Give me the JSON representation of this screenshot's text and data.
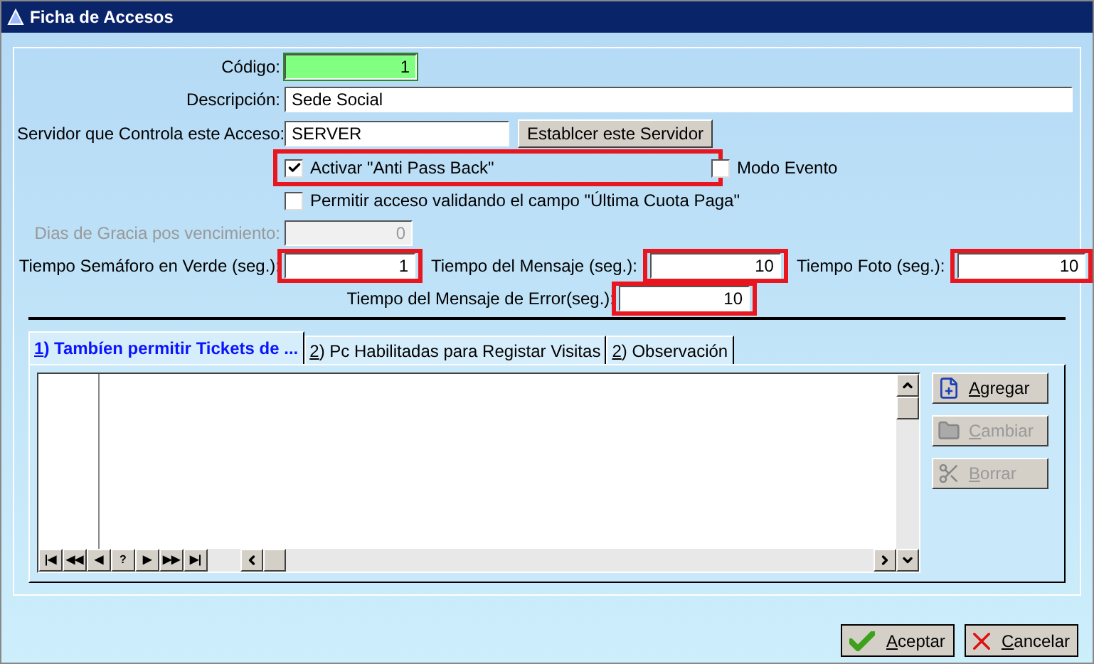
{
  "window": {
    "title": "Ficha de Accesos"
  },
  "form": {
    "codigo": {
      "label": "Código:",
      "value": "1"
    },
    "descripcion": {
      "label": "Descripción:",
      "value": "Sede Social"
    },
    "servidor": {
      "label": "Servidor que Controla este Acceso:",
      "value": "SERVER",
      "button": "Establcer este Servidor"
    },
    "anti_pass_back": {
      "label": "Activar \"Anti Pass Back\"",
      "checked": true,
      "highlighted": true
    },
    "modo_evento": {
      "label": "Modo Evento",
      "checked": false,
      "highlighted": false
    },
    "permitir": {
      "label": "Permitir acceso validando el campo \"Última Cuota Paga\"",
      "checked": false,
      "highlighted": false
    },
    "dias_gracia": {
      "label": "Dias de Gracia pos vencimiento:",
      "value": "0",
      "disabled": true,
      "highlighted": false
    },
    "tiempo_semaforo": {
      "label": "Tiempo Semáforo en Verde (seg.):",
      "value": "1",
      "disabled": false,
      "highlighted": true
    },
    "tiempo_mensaje": {
      "label": "Tiempo del Mensaje (seg.):",
      "value": "10",
      "disabled": false,
      "highlighted": true
    },
    "tiempo_foto": {
      "label": "Tiempo Foto (seg.):",
      "value": "10",
      "disabled": false,
      "highlighted": true
    },
    "tiempo_error": {
      "label": "Tiempo del Mensaje de Error(seg.):",
      "value": "10",
      "disabled": false,
      "highlighted": true
    }
  },
  "tabs": [
    {
      "key": "1",
      "text": ") Tambíen permitir Tickets de ...",
      "selected": true
    },
    {
      "key": "2",
      "text": ") Pc Habilitadas para Registar Visitas",
      "selected": false
    },
    {
      "key": "2",
      "text": ") Observación",
      "selected": false
    }
  ],
  "navigator": [
    "|◀",
    "◀◀",
    "◀",
    "?",
    "▶",
    "▶▶",
    "▶|"
  ],
  "side_buttons": [
    {
      "kind": "add",
      "key": "A",
      "text": "gregar",
      "disabled": false
    },
    {
      "kind": "edit",
      "key": "C",
      "text": "ambiar",
      "disabled": true
    },
    {
      "kind": "delete",
      "key": "B",
      "text": "orrar",
      "disabled": true
    }
  ],
  "footer_buttons": [
    {
      "kind": "ok",
      "key": "A",
      "text": "ceptar"
    },
    {
      "kind": "cancel",
      "key": "C",
      "text": "ancelar"
    }
  ]
}
